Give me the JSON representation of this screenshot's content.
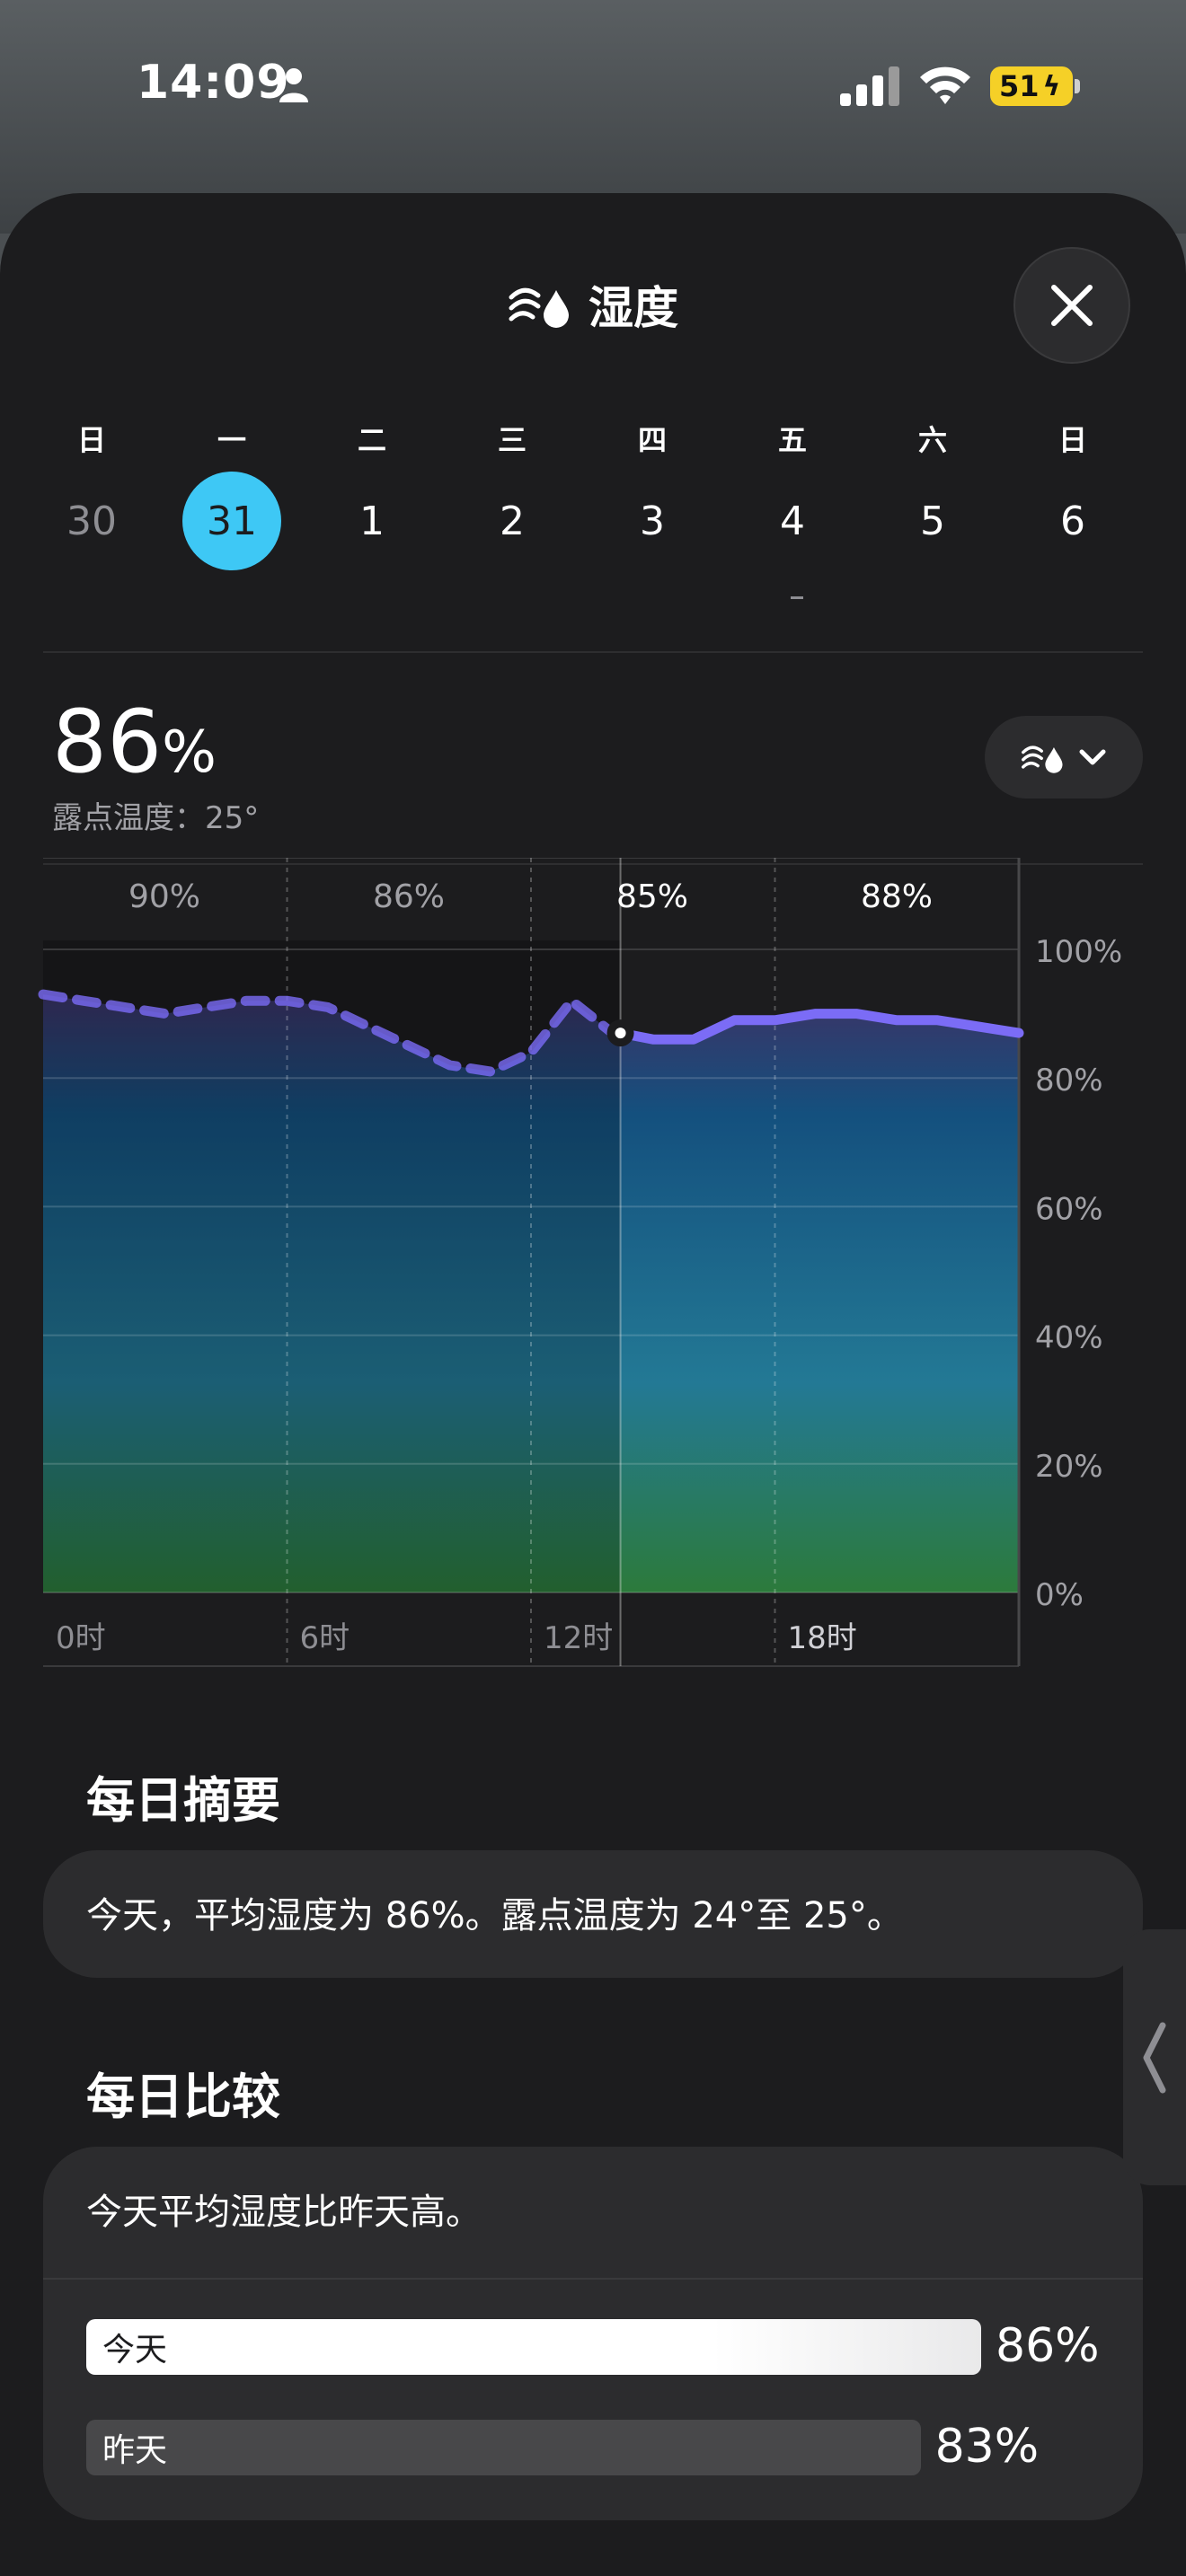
{
  "status_bar": {
    "time": "14:09",
    "battery": "51"
  },
  "header": {
    "title": "湿度"
  },
  "week": {
    "days": [
      {
        "name": "日",
        "num": "30"
      },
      {
        "name": "一",
        "num": "31"
      },
      {
        "name": "二",
        "num": "1"
      },
      {
        "name": "三",
        "num": "2"
      },
      {
        "name": "四",
        "num": "3"
      },
      {
        "name": "五",
        "num": "4"
      },
      {
        "name": "六",
        "num": "5"
      },
      {
        "name": "日",
        "num": "6"
      }
    ],
    "selected_index": 1
  },
  "current": {
    "value": "86",
    "unit": "%",
    "dew_point": "露点温度：25°"
  },
  "chart_data": {
    "type": "area",
    "y_tick_labels": [
      "100%",
      "80%",
      "60%",
      "40%",
      "20%",
      "0%"
    ],
    "ylim": [
      0,
      100
    ],
    "x_tick_labels": [
      "0时",
      "6时",
      "12时",
      "18时"
    ],
    "period_averages": [
      "90%",
      "86%",
      "85%",
      "88%"
    ],
    "now_hour": 14.2,
    "series": [
      {
        "x": [
          0,
          1,
          2,
          3,
          4,
          5,
          6,
          7,
          8,
          9,
          10,
          11,
          12,
          13,
          14,
          15,
          16,
          17,
          18,
          19,
          20,
          21,
          22,
          23,
          24
        ],
        "y": [
          93,
          92,
          91,
          90,
          91,
          92,
          92,
          91,
          88,
          85,
          82,
          81,
          84,
          92,
          87,
          86,
          86,
          89,
          89,
          90,
          90,
          89,
          89,
          88,
          87
        ]
      }
    ],
    "colors": {
      "line": "#7b6cf6",
      "area_top": "#3b3366",
      "area_mid": "#14507e",
      "area_bottom": "#2c7a3b"
    }
  },
  "summary": {
    "title": "每日摘要",
    "text": "今天，平均湿度为 86%。露点温度为 24°至 25°。"
  },
  "comparison": {
    "title": "每日比较",
    "text": "今天平均湿度比昨天高。",
    "today_label": "今天",
    "today_value": 86,
    "today_text": "86%",
    "yesterday_label": "昨天",
    "yesterday_value": 83,
    "yesterday_text": "83%"
  }
}
